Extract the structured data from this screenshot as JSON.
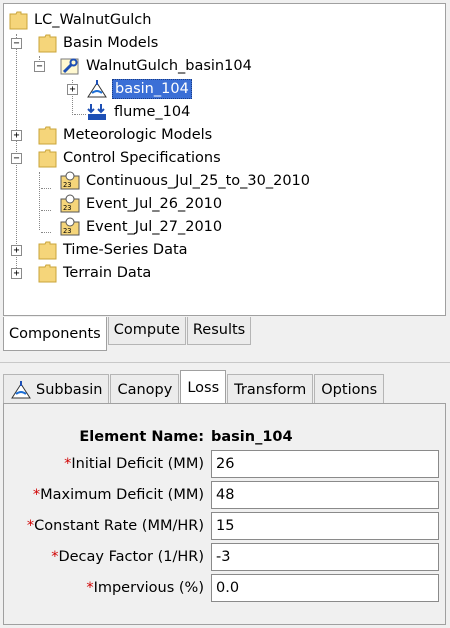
{
  "tree": {
    "root": "LC_WalnutGulch",
    "basin_models": "Basin Models",
    "basin_model": "WalnutGulch_basin104",
    "basin_element": "basin_104",
    "flume_element": "flume_104",
    "meteorologic_models": "Meteorologic Models",
    "control_specifications": "Control Specifications",
    "control_items": [
      "Continuous_Jul_25_to_30_2010",
      "Event_Jul_26_2010",
      "Event_Jul_27_2010"
    ],
    "time_series": "Time-Series Data",
    "terrain": "Terrain Data",
    "expander_minus": "−",
    "expander_plus": "+"
  },
  "bottom_tabs": [
    "Components",
    "Compute",
    "Results"
  ],
  "editor_tabs": [
    "Subbasin",
    "Canopy",
    "Loss",
    "Transform",
    "Options"
  ],
  "form": {
    "element_name_label": "Element Name:",
    "element_name_value": "basin_104",
    "required_mark": "*",
    "fields": [
      {
        "label": "Initial Deficit (MM)",
        "value": "26"
      },
      {
        "label": "Maximum Deficit (MM)",
        "value": "48"
      },
      {
        "label": "Constant Rate (MM/HR)",
        "value": "15"
      },
      {
        "label": "Decay Factor (1/HR)",
        "value": "-3"
      },
      {
        "label": "Impervious (%)",
        "value": "0.0"
      }
    ]
  },
  "icons": {
    "folder": "folder-icon",
    "basin_model": "basin-model-wrench-icon",
    "subbasin": "subbasin-icon",
    "sink": "sink-icon",
    "control": "control-spec-icon"
  },
  "colors": {
    "selection": "#3b6fd6",
    "folder": "#f5d57a",
    "required": "#d00000"
  }
}
